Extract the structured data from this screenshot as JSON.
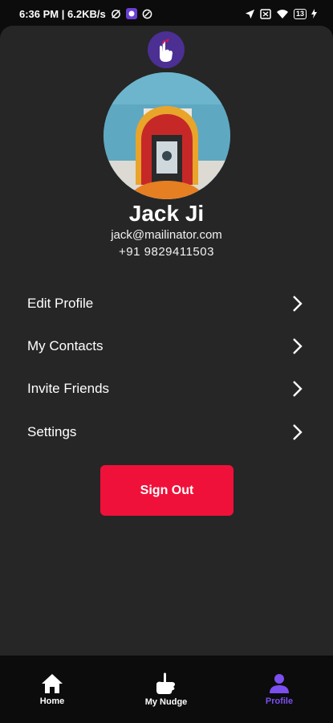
{
  "status_bar": {
    "time_speed": "6:36 PM | 6.2KB/s",
    "battery": "13"
  },
  "profile": {
    "name": "Jack Ji",
    "email": "jack@mailinator.com",
    "phone": "+91 9829411503"
  },
  "menu": {
    "items": [
      {
        "label": "Edit Profile"
      },
      {
        "label": "My Contacts"
      },
      {
        "label": "Invite Friends"
      },
      {
        "label": "Settings"
      }
    ]
  },
  "sign_out_label": "Sign Out",
  "tabs": [
    {
      "label": "Home",
      "icon": "home-icon",
      "active": false
    },
    {
      "label": "My Nudge",
      "icon": "nudge-hand-icon",
      "active": false
    },
    {
      "label": "Profile",
      "icon": "person-icon",
      "active": true
    }
  ],
  "colors": {
    "accent": "#7b4ff0",
    "sign_out": "#f0113a",
    "background": "#262626",
    "tab_bar": "#0c0c0c"
  }
}
